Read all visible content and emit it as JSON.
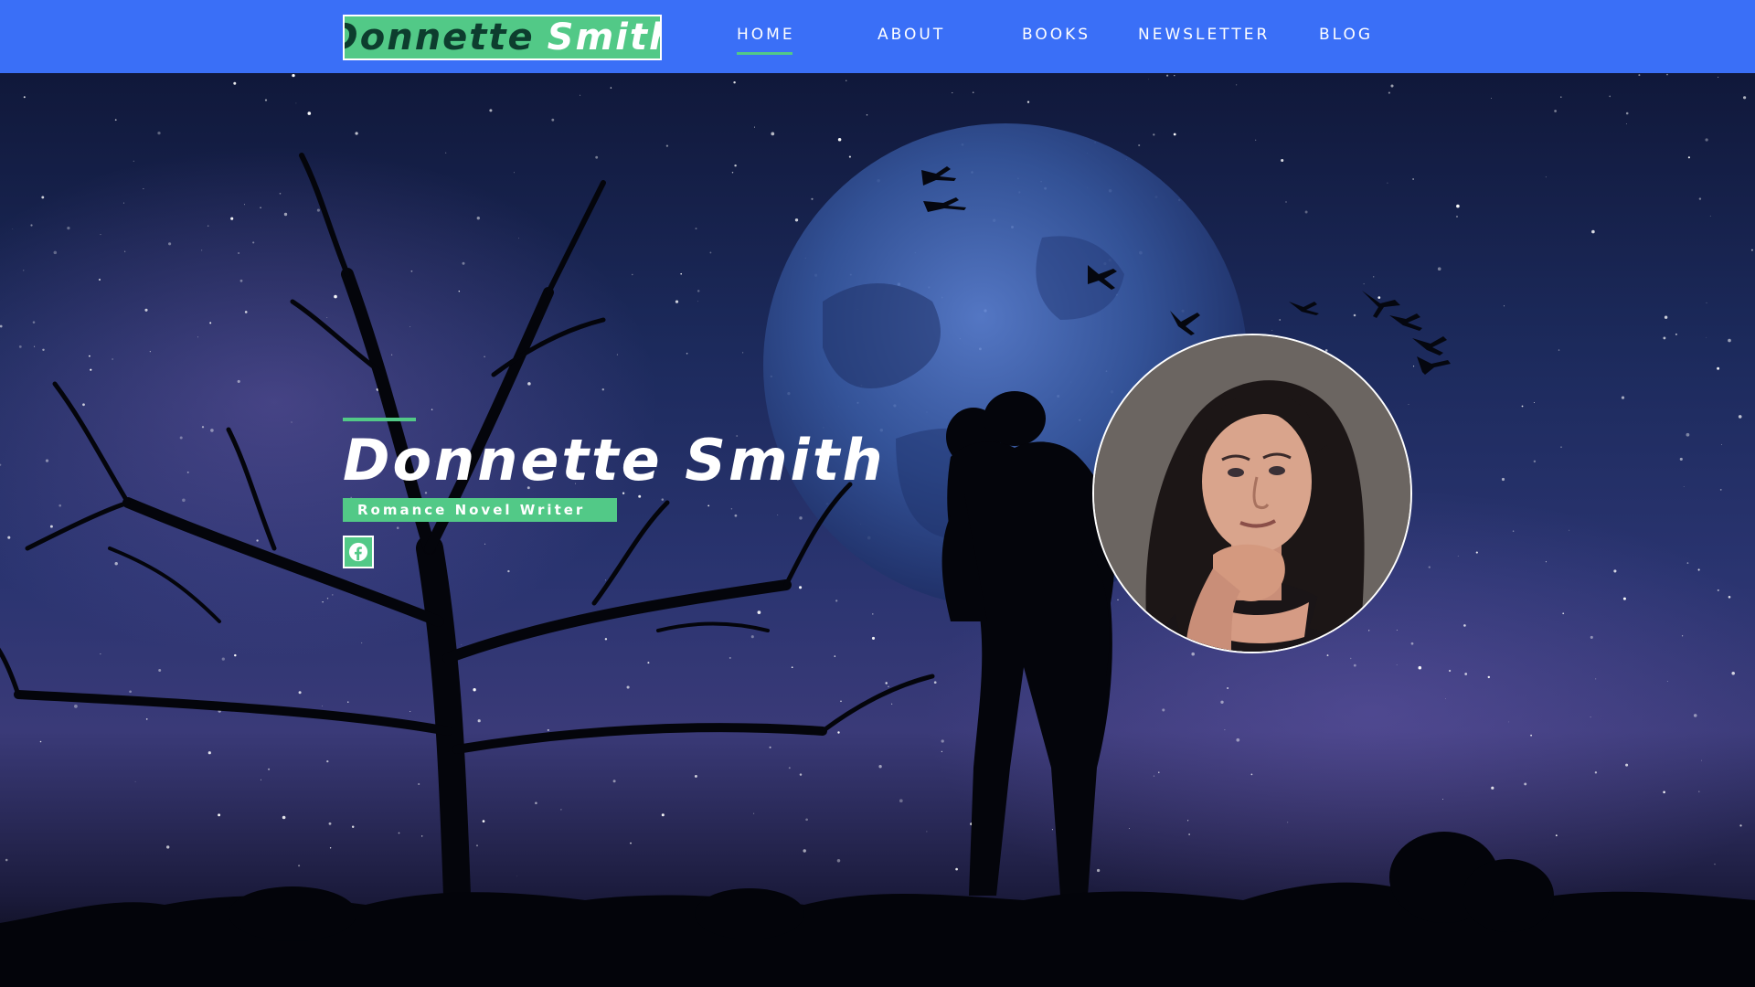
{
  "header": {
    "logo": {
      "first": "Donnette",
      "last": "Smith"
    },
    "nav": [
      {
        "label": "HOME",
        "active": true
      },
      {
        "label": "ABOUT",
        "active": false
      },
      {
        "label": "BOOKS",
        "active": false
      },
      {
        "label": "NEWSLETTER",
        "active": false
      },
      {
        "label": "BLOG",
        "active": false
      }
    ]
  },
  "hero": {
    "title": "Donnette Smith",
    "subtitle": "Romance Novel Writer",
    "social": [
      {
        "icon": "facebook-icon"
      }
    ]
  },
  "colors": {
    "nav_background": "#3a6ff7",
    "accent_green": "#52c987",
    "logo_dark_text": "#0d3d2e",
    "text": "#ffffff"
  }
}
